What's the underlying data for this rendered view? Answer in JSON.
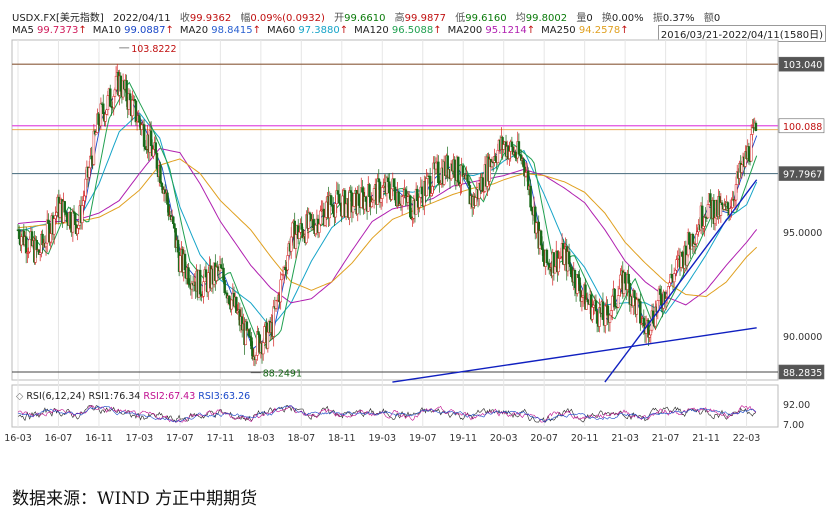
{
  "header": {
    "symbol": "USDX.FX[美元指数]",
    "date": "2022/04/11",
    "close_label": "收",
    "close": "99.9362",
    "change_label": "幅",
    "change": "0.09%(0.0932)",
    "open_label": "开",
    "open": "99.6610",
    "high_label": "高",
    "high": "99.9877",
    "low_label": "低",
    "low": "99.6160",
    "avg_label": "均",
    "avg": "99.8002",
    "vol_label": "量",
    "vol": "0",
    "turnover_label": "换",
    "turnover": "0.00%",
    "amp_label": "振",
    "amp": "0.37%",
    "amount_label": "额",
    "amount": "0"
  },
  "ma_legend": [
    {
      "label": "MA5",
      "value": "99.7373",
      "arrow": "↑",
      "color": "#d01a5a"
    },
    {
      "label": "MA10",
      "value": "99.0887",
      "arrow": "↑",
      "color": "#1a48c8"
    },
    {
      "label": "MA20",
      "value": "98.8415",
      "arrow": "↑",
      "color": "#2a60d0"
    },
    {
      "label": "MA60",
      "value": "97.3880",
      "arrow": "↑",
      "color": "#16a4c8"
    },
    {
      "label": "MA120",
      "value": "96.5088",
      "arrow": "↑",
      "color": "#20a050"
    },
    {
      "label": "MA200",
      "value": "95.1214",
      "arrow": "↑",
      "color": "#b020b0"
    },
    {
      "label": "MA250",
      "value": "94.2578",
      "arrow": "↑",
      "color": "#e0a020"
    }
  ],
  "date_range": "2016/03/21-2022/04/11(1580日)",
  "rsi_legend": {
    "title": "RSI(6,12,24)",
    "rsi1_label": "RSI1:",
    "rsi1": "76.34",
    "rsi2_label": "RSI2:",
    "rsi2": "67.43",
    "rsi3_label": "RSI3:",
    "rsi3": "63.26"
  },
  "caption": "数据来源：WIND 方正中期期货",
  "colors": {
    "up": "#d42020",
    "down": "#186818",
    "price_axis_box": "#555555",
    "trendline": "#1020c0",
    "pink_line": "#e050e0",
    "level_line": "#5a7a8a"
  },
  "chart_data": [
    {
      "type": "candlestick",
      "title": "USDX.FX[美元指数]",
      "x_tick_labels": [
        "16-03",
        "16-07",
        "16-11",
        "17-03",
        "17-07",
        "17-11",
        "18-03",
        "18-07",
        "18-11",
        "19-03",
        "19-07",
        "19-11",
        "20-03",
        "20-07",
        "20-11",
        "21-03",
        "21-07",
        "21-11",
        "22-03"
      ],
      "y_tick_labels": [
        "103.040",
        "100.088",
        "97.7967",
        "95.0000",
        "90.0000",
        "88.2835"
      ],
      "ylim": [
        87.9,
        104.2
      ],
      "marked_extremes": [
        {
          "label": "103.8222",
          "date": "2017-01",
          "value": 103.8222
        },
        {
          "label": "88.2491",
          "date": "2018-02",
          "value": 88.2491
        }
      ],
      "horizontal_levels": [
        103.04,
        100.088,
        97.7967,
        88.2835
      ],
      "trendlines": [
        {
          "from": [
            "2019-04",
            87.8
          ],
          "to": [
            "2022-04",
            90.4
          ]
        },
        {
          "from": [
            "2021-01",
            87.8
          ],
          "to": [
            "2022-04",
            97.5
          ]
        }
      ],
      "close_series": {
        "x": [
          "2016-03",
          "2016-05",
          "2016-07",
          "2016-09",
          "2016-11",
          "2017-01",
          "2017-03",
          "2017-05",
          "2017-07",
          "2017-09",
          "2017-11",
          "2018-02",
          "2018-04",
          "2018-06",
          "2018-08",
          "2018-10",
          "2018-12",
          "2019-02",
          "2019-04",
          "2019-06",
          "2019-08",
          "2019-10",
          "2019-12",
          "2020-02",
          "2020-03",
          "2020-05",
          "2020-07",
          "2020-09",
          "2020-11",
          "2021-01",
          "2021-03",
          "2021-05",
          "2021-07",
          "2021-09",
          "2021-11",
          "2022-01",
          "2022-03",
          "2022-04"
        ],
        "values": [
          95.1,
          93.9,
          96.2,
          95.4,
          100.4,
          102.2,
          100.3,
          98.1,
          93.6,
          92.4,
          93.1,
          89.4,
          90.2,
          94.8,
          95.3,
          96.4,
          96.3,
          96.8,
          97.1,
          96.2,
          97.6,
          98.3,
          96.4,
          98.7,
          99.2,
          98.4,
          93.4,
          93.9,
          91.8,
          90.8,
          92.8,
          90.3,
          92.2,
          94.1,
          96.2,
          95.9,
          98.6,
          99.94
        ]
      },
      "moving_averages": [
        {
          "name": "MA60",
          "values": [
            95.0,
            95.3,
            95.5,
            95.6,
            97.3,
            99.8,
            100.7,
            99.5,
            96.2,
            93.9,
            92.7,
            91.6,
            90.4,
            91.6,
            93.6,
            95.2,
            96.0,
            96.5,
            97.0,
            96.9,
            97.1,
            97.8,
            97.7,
            98.0,
            98.4,
            98.9,
            96.8,
            94.5,
            93.3,
            91.5,
            91.6,
            91.6,
            91.1,
            92.4,
            93.9,
            95.6,
            96.3,
            97.39
          ]
        },
        {
          "name": "MA200",
          "values": [
            95.4,
            95.5,
            95.5,
            95.6,
            95.9,
            96.5,
            97.8,
            99.0,
            98.8,
            97.3,
            95.5,
            93.4,
            92.3,
            91.6,
            91.8,
            92.6,
            94.1,
            95.5,
            96.1,
            96.3,
            96.6,
            97.2,
            97.4,
            97.6,
            97.7,
            98.0,
            97.7,
            97.1,
            96.4,
            95.1,
            93.6,
            92.6,
            91.9,
            91.5,
            92.2,
            93.4,
            94.5,
            95.12
          ]
        },
        {
          "name": "MA250",
          "values": [
            95.2,
            95.3,
            95.4,
            95.5,
            95.7,
            96.2,
            97.0,
            98.2,
            98.5,
            97.8,
            96.5,
            95.1,
            93.8,
            92.6,
            92.2,
            92.6,
            93.5,
            94.7,
            95.6,
            96.0,
            96.4,
            96.8,
            97.1,
            97.3,
            97.5,
            97.8,
            97.7,
            97.4,
            96.9,
            95.9,
            94.5,
            93.5,
            92.6,
            92.0,
            91.9,
            92.6,
            93.8,
            94.26
          ]
        }
      ]
    },
    {
      "type": "line",
      "title": "RSI(6,12,24)",
      "y_tick_labels": [
        "92.00",
        "7.00"
      ],
      "series": [
        {
          "name": "RSI1",
          "latest": 76.34
        },
        {
          "name": "RSI2",
          "latest": 67.43
        },
        {
          "name": "RSI3",
          "latest": 63.26
        }
      ]
    }
  ]
}
